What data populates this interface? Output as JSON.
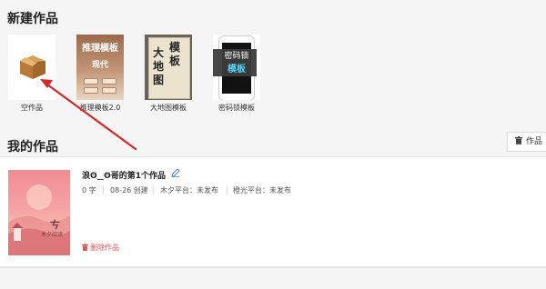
{
  "new_section": {
    "title": "新建作品",
    "templates": [
      {
        "label": "空作品",
        "icon": "cardboard-box-icon"
      },
      {
        "label": "推理模板2.0",
        "thumb_line1": "推理模板",
        "thumb_line2": "现代"
      },
      {
        "label": "大地图模板",
        "thumb_chars": [
          "大",
          "地",
          "图",
          "模",
          "板"
        ]
      },
      {
        "label": "密码锁模板",
        "thumb_line1": "密码锁",
        "thumb_line2": "模板"
      }
    ]
  },
  "my_section": {
    "title": "我的作品",
    "sort_button": {
      "label": "作品",
      "icon": "trash-icon"
    }
  },
  "work": {
    "title": "浪ʘ‿ʘ哥的第1个作品",
    "edit_icon": "pencil-icon",
    "word_count": "0 字",
    "created": "08-26 创建",
    "platform1": "木夕平台：未发布",
    "platform2": "橙光平台：未发布",
    "delete_label": "删除作品",
    "cover_badge": "木夕阅读"
  },
  "colors": {
    "accent_red": "#e0565c",
    "arrow": "#d22a2a",
    "cover_top": "#f08c93",
    "cover_bottom": "#f7c0b1"
  }
}
